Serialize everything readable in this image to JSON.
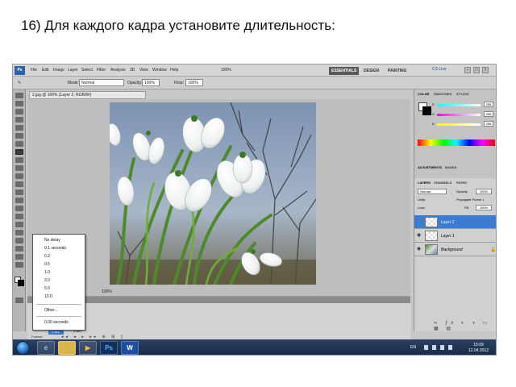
{
  "slide": {
    "title": "16) Для каждого кадра установите длительность:"
  },
  "photoshop": {
    "menu": [
      "File",
      "Edit",
      "Image",
      "Layer",
      "Select",
      "Filter",
      "Analysis",
      "3D",
      "View",
      "Window",
      "Help"
    ],
    "zoom_percent": "100%",
    "workspaces": [
      "ESSENTIALS",
      "DESIGN",
      "PAINTING"
    ],
    "cs_live": "CS Live",
    "options": {
      "mode_label": "Mode:",
      "mode_value": "Normal",
      "opacity_label": "Opacity:",
      "opacity_value": "100%",
      "flow_label": "Flow:",
      "flow_value": "100%"
    },
    "document_tab": "2.jpg @ 100% (Layer 2, RGB/8#)",
    "status_zoom": "100%",
    "animation_panel": {
      "frame_delay": "0 sec.",
      "frame_delay_label": "5 sec.",
      "loop": "Forever"
    },
    "delay_menu": {
      "options": [
        "No delay",
        "0.1 seconds",
        "0.2",
        "0.5",
        "1.0",
        "2.0",
        "5.0",
        "10.0"
      ],
      "other": "Other...",
      "current": "0,00 seconds"
    },
    "color_panel": {
      "tabs": [
        "COLOR",
        "SWATCHES",
        "STYLES"
      ],
      "rgb_labels": [
        "R",
        "G",
        "B"
      ],
      "rgb_values": [
        "255",
        "255",
        "255"
      ]
    },
    "adjustments_tabs": [
      "ADJUSTMENTS",
      "MASKS"
    ],
    "layers_panel": {
      "tabs": [
        "LAYERS",
        "CHANNELS",
        "PATHS"
      ],
      "blend_mode": "Normal",
      "opacity_label": "Opacity:",
      "opacity_value": "100%",
      "unify_label": "Unify:",
      "propagate_label": "Propagate Frame 1",
      "lock_label": "Lock:",
      "fill_label": "Fill:",
      "fill_value": "100%",
      "layers": [
        {
          "name": "Layer 2",
          "selected": true
        },
        {
          "name": "Layer 1",
          "selected": false
        },
        {
          "name": "Background",
          "selected": false
        }
      ]
    }
  },
  "taskbar": {
    "language": "EN",
    "time": "15:09",
    "date": "12.04.2012",
    "apps": [
      "ie-icon",
      "explorer-icon",
      "media-player-icon",
      "photoshop-icon",
      "word-icon"
    ],
    "ps_label": "Ps",
    "word_label": "W"
  },
  "colors": {
    "selection_blue": "#3b7bd2",
    "taskbar": "#1f3656",
    "panel_gray": "#c8c8c8"
  }
}
